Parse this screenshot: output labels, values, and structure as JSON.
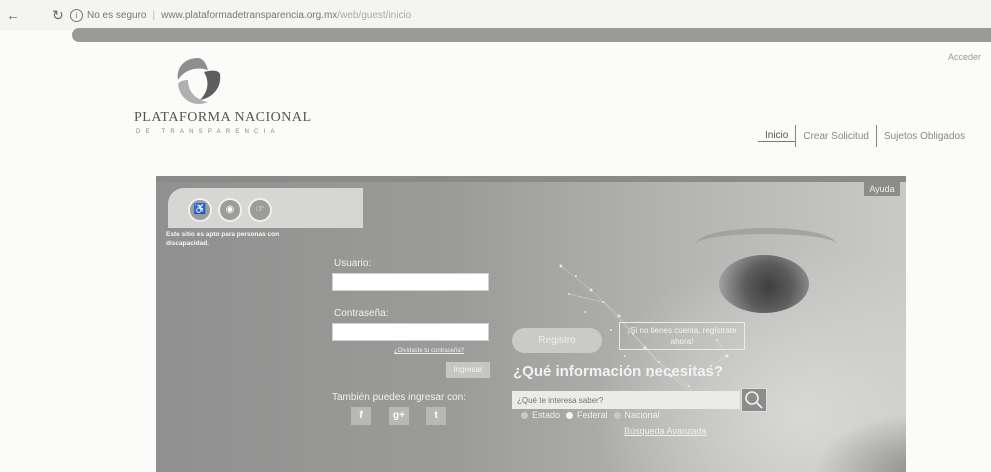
{
  "browser": {
    "security_label": "No es seguro",
    "url": "www.plataformadetransparencia.org.mx",
    "url_tail": "/web/guest/inicio"
  },
  "header": {
    "acceder": "Acceder",
    "logo_title": "PLATAFORMA NACIONAL",
    "logo_subtitle": "DE TRANSPARENCIA"
  },
  "nav": {
    "items": [
      "Inicio",
      "Crear Solicitud",
      "Sujetos Obligados"
    ]
  },
  "hero": {
    "ayuda": "Ayuda",
    "accessibility_text": "Este sitio es apto para personas con discapacidad.",
    "accessibility_icons": [
      "hearing-icon",
      "visual-icon",
      "sign-language-icon"
    ],
    "login": {
      "user_label": "Usuario:",
      "password_label": "Contraseña:",
      "forgot": "¿Olvidaste tu contraseña?",
      "submit": "Ingresar",
      "social_prompt": "También puedes ingresar con:",
      "social": [
        "f",
        "g+",
        "t"
      ]
    },
    "registro": "Registro",
    "signup_hint": "¡Si no tienes cuenta, regístrate ahora!",
    "question": "¿Qué información necesitas?",
    "search_placeholder": "¿Qué te interesa saber?",
    "scopes": [
      "Estado",
      "Federal",
      "Nacional"
    ],
    "selected_scope": "Federal",
    "advanced": "Búsqueda Avanzada"
  },
  "colors": {
    "hero_bg": "#9b9b99",
    "band": "#9a9a98",
    "text": "#555555"
  }
}
